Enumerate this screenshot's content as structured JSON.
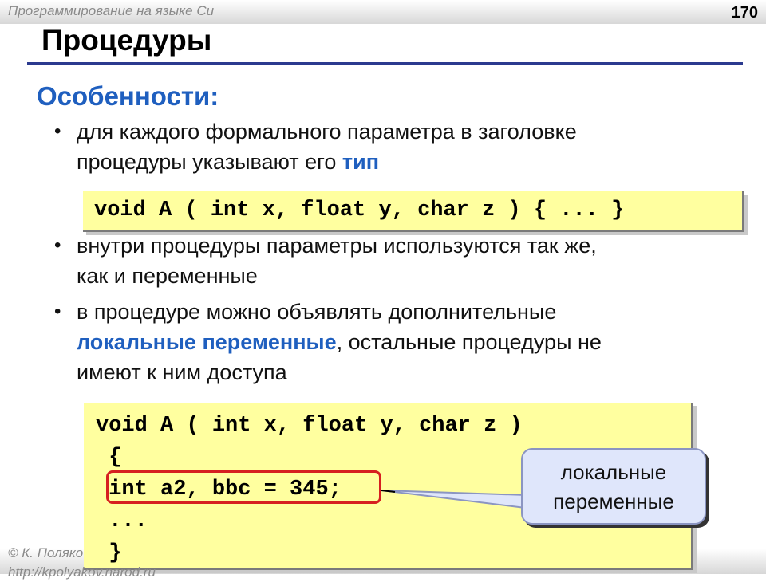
{
  "header": {
    "course": "Программирование на языке Си",
    "page": "170"
  },
  "title": "Процедуры",
  "subheading": "Особенности:",
  "bullets": {
    "b1_line1": "для каждого формального параметра в заголовке",
    "b1_line2_pre": "процедуры указывают его ",
    "b1_line2_hl": "тип",
    "b2_line1": "внутри процедуры параметры используются так же,",
    "b2_line2": "как и переменные",
    "b3_line1": "в процедуре можно объявлять дополнительные",
    "b3_line2_hl": "локальные переменные",
    "b3_line2_post": ", остальные процедуры не",
    "b3_line3": "имеют к ним доступа"
  },
  "code1": "void A ( int x, float y, char z ) { ... }",
  "code2": [
    "void A ( int x, float y, char z )",
    " {",
    " int a2, bbc = 345;",
    " ...",
    " }"
  ],
  "callout": {
    "line1": "локальные",
    "line2": "переменные"
  },
  "footer": {
    "author": "© К. Поляко",
    "url": "http://kpolyakov.narod.ru"
  }
}
